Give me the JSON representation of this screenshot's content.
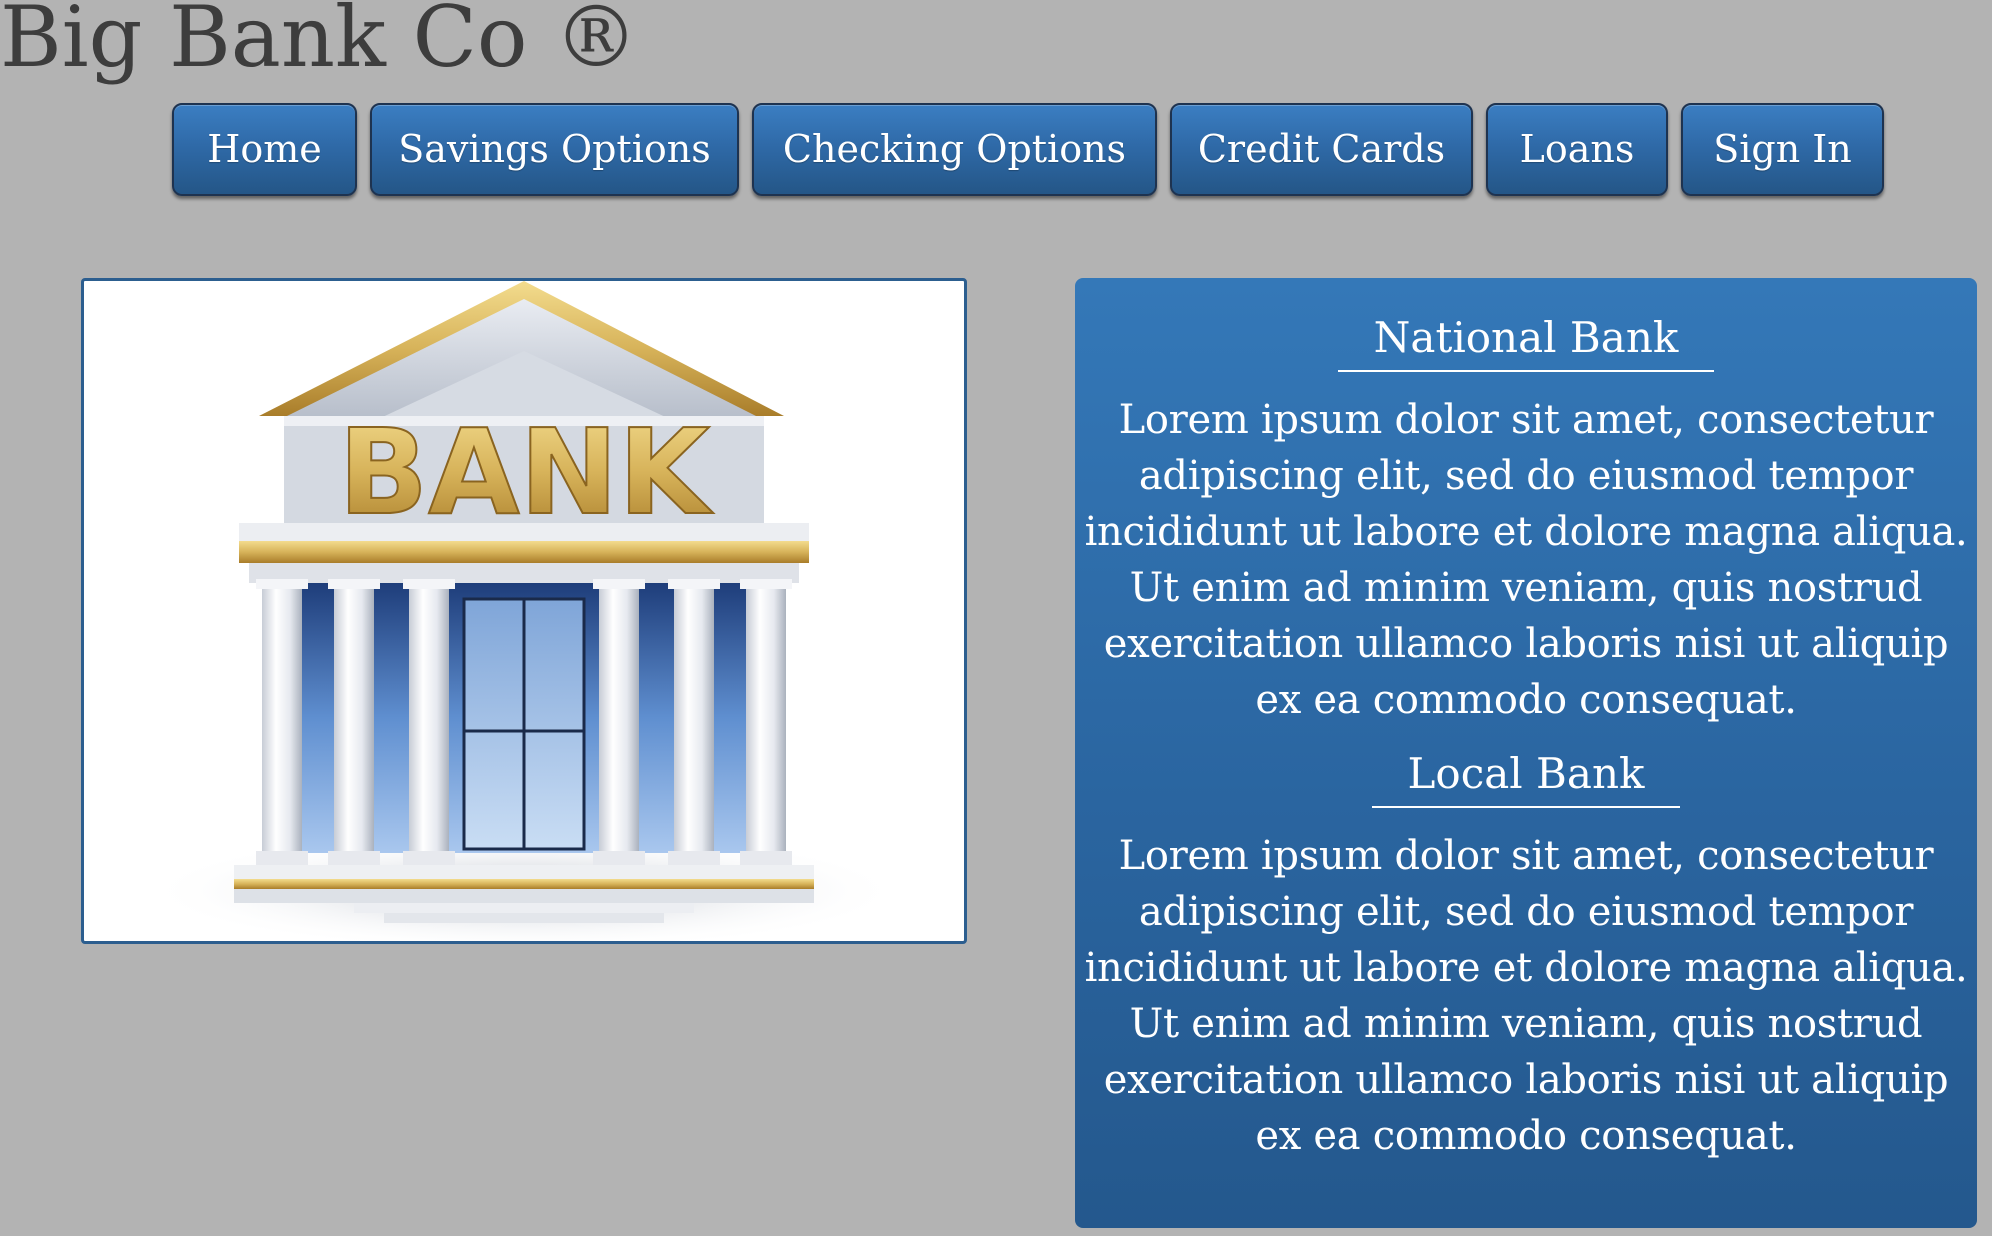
{
  "header": {
    "title": "Big Bank Co ®"
  },
  "nav": {
    "items": [
      {
        "label": "Home"
      },
      {
        "label": "Savings Options"
      },
      {
        "label": "Checking Options"
      },
      {
        "label": "Credit Cards"
      },
      {
        "label": "Loans"
      },
      {
        "label": "Sign In"
      }
    ]
  },
  "hero": {
    "sign_text": "BANK"
  },
  "panel": {
    "sections": [
      {
        "heading": "National Bank",
        "body": "Lorem ipsum dolor sit amet, consectetur adipiscing elit, sed do eiusmod tempor incididunt ut labore et dolore magna aliqua. Ut enim ad minim veniam, quis nostrud exercitation ullamco laboris nisi ut aliquip ex ea commodo consequat."
      },
      {
        "heading": "Local Bank",
        "body": "Lorem ipsum dolor sit amet, consectetur adipiscing elit, sed do eiusmod tempor incididunt ut labore et dolore magna aliqua. Ut enim ad minim veniam, quis nostrud exercitation ullamco laboris nisi ut aliquip ex ea commodo consequat."
      }
    ]
  },
  "colors": {
    "page_background": "#b3b3b3",
    "title_text": "#3d3d3d",
    "button_blue": "#2f6aa8",
    "panel_blue": "#2a65a0",
    "gold": "#c9a24a"
  }
}
